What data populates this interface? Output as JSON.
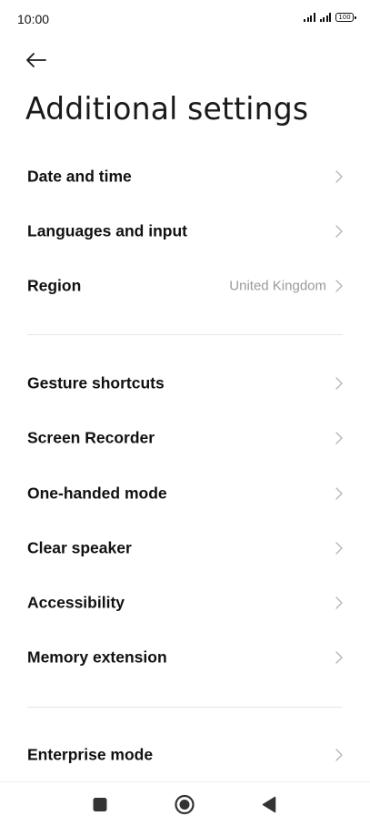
{
  "status_bar": {
    "time": "10:00",
    "battery": "100"
  },
  "header": {
    "back_icon": "arrow-left-icon",
    "title": "Additional settings"
  },
  "groups": [
    {
      "items": [
        {
          "label": "Date and time",
          "value": ""
        },
        {
          "label": "Languages and input",
          "value": ""
        },
        {
          "label": "Region",
          "value": "United Kingdom"
        }
      ]
    },
    {
      "items": [
        {
          "label": "Gesture shortcuts",
          "value": ""
        },
        {
          "label": "Screen Recorder",
          "value": ""
        },
        {
          "label": "One-handed mode",
          "value": ""
        },
        {
          "label": "Clear speaker",
          "value": ""
        },
        {
          "label": "Accessibility",
          "value": ""
        },
        {
          "label": "Memory extension",
          "value": ""
        }
      ]
    },
    {
      "items": [
        {
          "label": "Enterprise mode",
          "value": ""
        }
      ]
    }
  ],
  "nav_bar": {
    "recents_icon": "square-icon",
    "home_icon": "circle-icon",
    "back_icon": "triangle-back-icon"
  },
  "colors": {
    "text_primary": "#111111",
    "text_secondary": "#9a9a9a",
    "divider": "#e6e6e6",
    "chevron": "#b5b5b5"
  }
}
